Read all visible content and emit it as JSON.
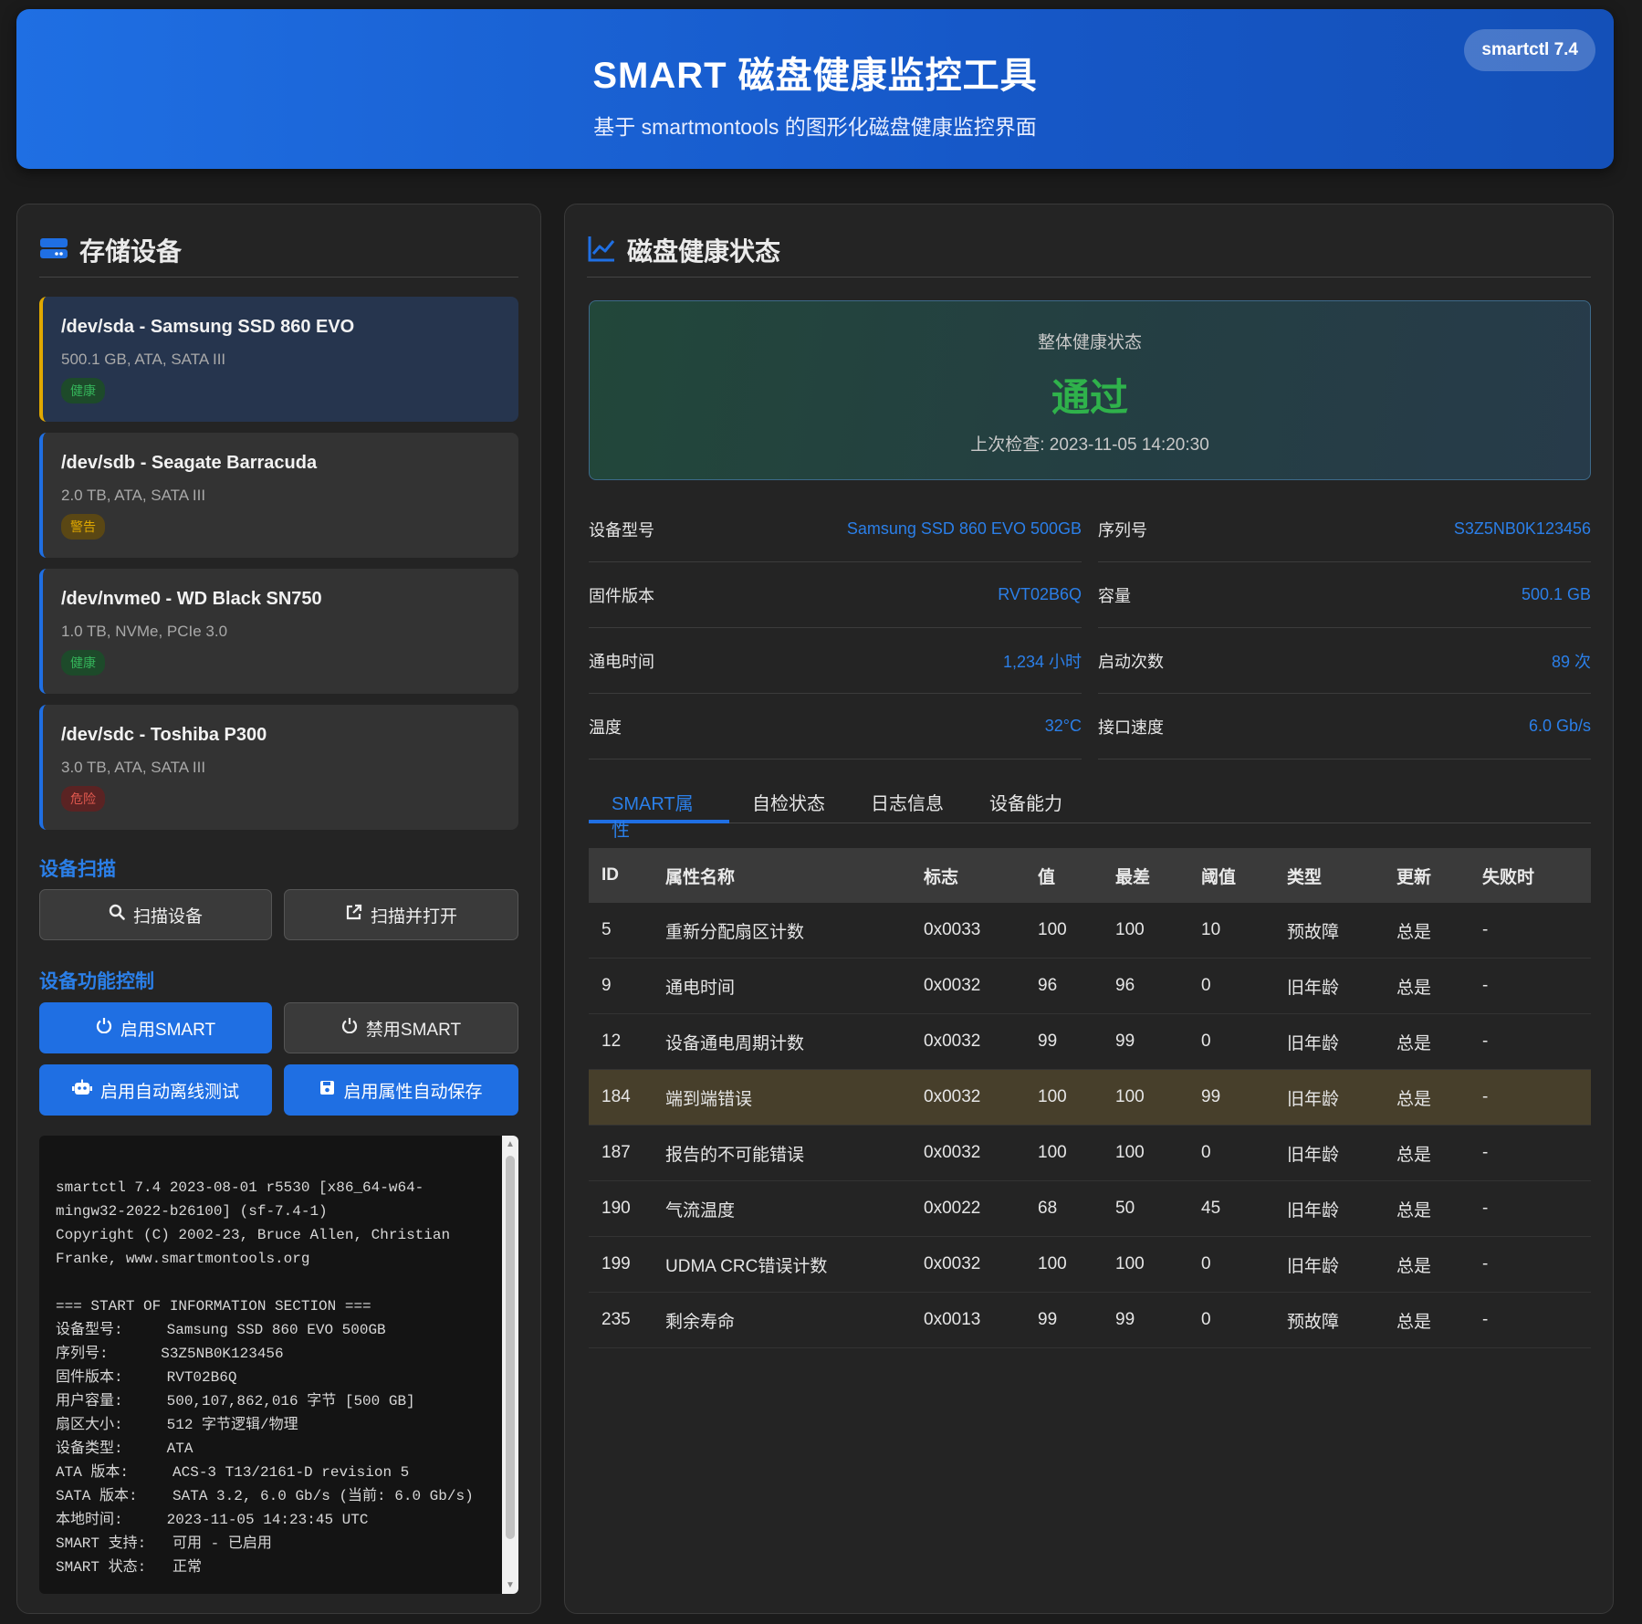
{
  "header": {
    "title": "SMART 磁盘健康监控工具",
    "subtitle": "基于 smartmontools 的图形化磁盘健康监控界面",
    "version_badge": "smartctl 7.4"
  },
  "sidebar": {
    "title": "存储设备",
    "icon": "hard-drive-icon",
    "devices": [
      {
        "name": "/dev/sda - Samsung SSD 860 EVO",
        "spec": "500.1 GB, ATA, SATA III",
        "status": "健康"
      },
      {
        "name": "/dev/sdb - Seagate Barracuda",
        "spec": "2.0 TB, ATA, SATA III",
        "status": "警告"
      },
      {
        "name": "/dev/nvme0 - WD Black SN750",
        "spec": "1.0 TB, NVMe, PCIe 3.0",
        "status": "健康"
      },
      {
        "name": "/dev/sdc - Toshiba P300",
        "spec": "3.0 TB, ATA, SATA III",
        "status": "危险"
      }
    ],
    "scan_section": "设备扫描",
    "scan_button": "扫描设备",
    "scan_open_button": "扫描并打开",
    "control_section": "设备功能控制",
    "enable_smart": "启用SMART",
    "disable_smart": "禁用SMART",
    "enable_auto_offline": "启用自动离线测试",
    "enable_attr_autosave": "启用属性自动保存",
    "console_text": "smartctl 7.4 2023-08-01 r5530 [x86_64-w64-mingw32-2022-b26100] (sf-7.4-1)\nCopyright (C) 2002-23, Bruce Allen, Christian Franke, www.smartmontools.org\n\n=== START OF INFORMATION SECTION ===\n设备型号:     Samsung SSD 860 EVO 500GB\n序列号:      S3Z5NB0K123456\n固件版本:     RVT02B6Q\n用户容量:     500,107,862,016 字节 [500 GB]\n扇区大小:     512 字节逻辑/物理\n设备类型:     ATA\nATA 版本:     ACS-3 T13/2161-D revision 5\nSATA 版本:    SATA 3.2, 6.0 Gb/s (当前: 6.0 Gb/s)\n本地时间:     2023-11-05 14:23:45 UTC\nSMART 支持:   可用 - 已启用\nSMART 状态:   正常"
  },
  "main": {
    "title": "磁盘健康状态",
    "icon": "chart-line-icon",
    "health": {
      "label": "整体健康状态",
      "value": "通过",
      "last_check": "上次检查: 2023-11-05 14:20:30"
    },
    "info": [
      {
        "k": "设备型号",
        "v": "Samsung SSD 860 EVO 500GB"
      },
      {
        "k": "序列号",
        "v": "S3Z5NB0K123456"
      },
      {
        "k": "固件版本",
        "v": "RVT02B6Q"
      },
      {
        "k": "容量",
        "v": "500.1 GB"
      },
      {
        "k": "通电时间",
        "v": "1,234 小时"
      },
      {
        "k": "启动次数",
        "v": "89 次"
      },
      {
        "k": "温度",
        "v": "32°C"
      },
      {
        "k": "接口速度",
        "v": "6.0 Gb/s"
      }
    ],
    "tabs": [
      "SMART属性",
      "自检状态",
      "日志信息",
      "设备能力"
    ],
    "table": {
      "headers": [
        "ID",
        "属性名称",
        "标志",
        "值",
        "最差",
        "阈值",
        "类型",
        "更新",
        "失败时"
      ],
      "rows": [
        [
          "5",
          "重新分配扇区计数",
          "0x0033",
          "100",
          "100",
          "10",
          "预故障",
          "总是",
          "-"
        ],
        [
          "9",
          "通电时间",
          "0x0032",
          "96",
          "96",
          "0",
          "旧年龄",
          "总是",
          "-"
        ],
        [
          "12",
          "设备通电周期计数",
          "0x0032",
          "99",
          "99",
          "0",
          "旧年龄",
          "总是",
          "-"
        ],
        [
          "184",
          "端到端错误",
          "0x0032",
          "100",
          "100",
          "99",
          "旧年龄",
          "总是",
          "-"
        ],
        [
          "187",
          "报告的不可能错误",
          "0x0032",
          "100",
          "100",
          "0",
          "旧年龄",
          "总是",
          "-"
        ],
        [
          "190",
          "气流温度",
          "0x0022",
          "68",
          "50",
          "45",
          "旧年龄",
          "总是",
          "-"
        ],
        [
          "199",
          "UDMA CRC错误计数",
          "0x0032",
          "100",
          "100",
          "0",
          "旧年龄",
          "总是",
          "-"
        ],
        [
          "235",
          "剩余寿命",
          "0x0013",
          "99",
          "99",
          "0",
          "预故障",
          "总是",
          "-"
        ]
      ]
    }
  },
  "colors": {
    "accent": "#1f6fe3",
    "ok": "#35b35a",
    "warn": "#e0a800",
    "danger": "#e0584e"
  }
}
